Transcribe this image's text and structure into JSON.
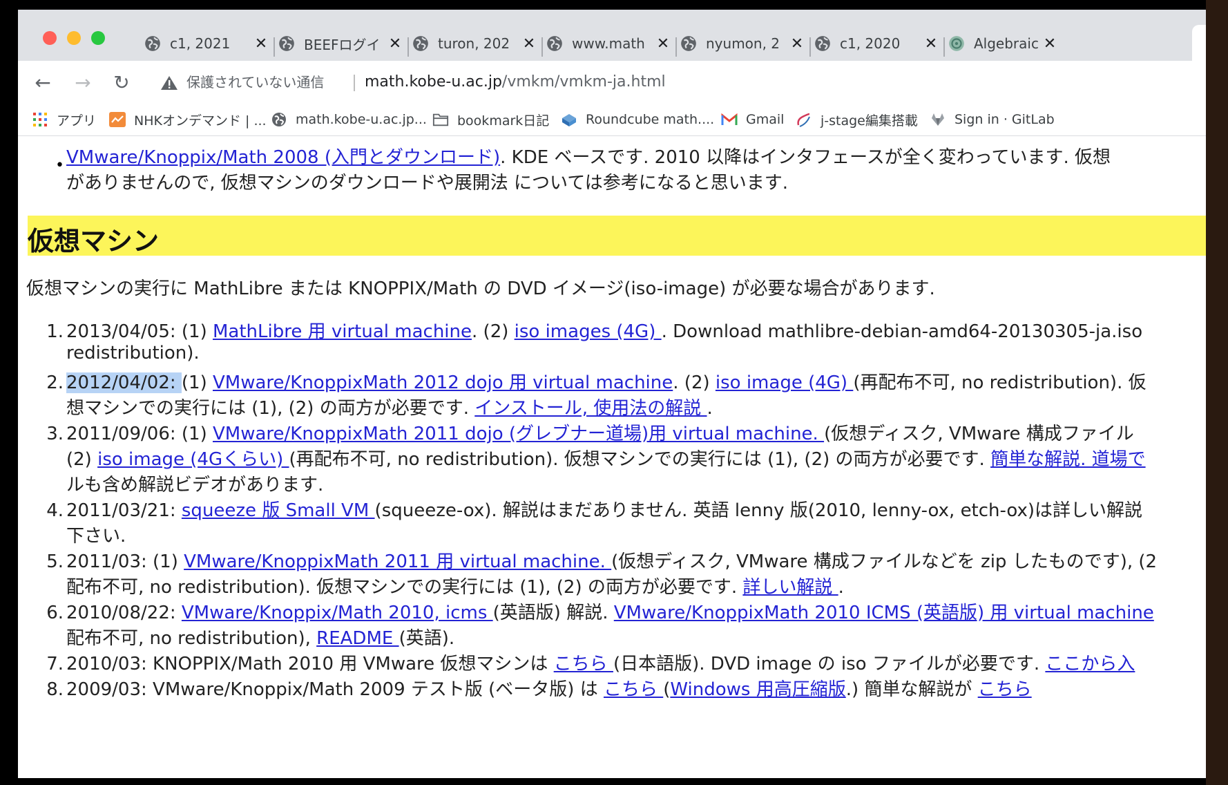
{
  "tabs": [
    {
      "label": "c1, 2021"
    },
    {
      "label": "BEEFログイ"
    },
    {
      "label": "turon, 202"
    },
    {
      "label": "www.math"
    },
    {
      "label": "nyumon, 2"
    },
    {
      "label": "c1, 2020"
    },
    {
      "label": "Algebraic S"
    }
  ],
  "tab_close": "✕",
  "toolbar": {
    "back": "←",
    "forward": "→",
    "reload": "↻",
    "security_text": "保護されていない通信",
    "url_host": "math.kobe-u.ac.jp",
    "url_path": "/vmkm/vmkm-ja.html"
  },
  "bookmarks": [
    {
      "label": "アプリ"
    },
    {
      "label": "NHKオンデマンド | ..."
    },
    {
      "label": "math.kobe-u.ac.jp..."
    },
    {
      "label": "bookmark日記"
    },
    {
      "label": "Roundcube math...."
    },
    {
      "label": "Gmail"
    },
    {
      "label": "j-stage編集搭載"
    },
    {
      "label": "Sign in · GitLab"
    }
  ],
  "intro_bullet": {
    "link": "VMware/Knoppix/Math 2008 (入門とダウンロード)",
    "text1": ". KDE ベースです. 2010 以降はインタフェースが全く変わっています. 仮想",
    "text2": "がありませんので, 仮想マシンのダウンロードや展開法 については参考になると思います."
  },
  "heading": "仮想マシン",
  "intro_paragraph": "仮想マシンの実行に MathLibre または KNOPPIX/Math の DVD イメージ(iso-image) が必要な場合があります.",
  "items": [
    {
      "num": "1.",
      "l1_a": "2013/04/05: (1) ",
      "l1_link1": "MathLibre 用 virtual machine",
      "l1_b": ". (2) ",
      "l1_link2": "iso images (4G) ",
      "l1_c": ". Download mathlibre-debian-amd64-20130305-ja.iso",
      "l2": "redistribution)."
    },
    {
      "num": "2.",
      "l1_hl": "2012/04/02: ",
      "l1_a": "(1) ",
      "l1_link1": "VMware/KnoppixMath 2012 dojo 用 virtual machine",
      "l1_b": ". (2) ",
      "l1_link2": "iso image (4G) ",
      "l1_c": "(再配布不可, no redistribution). 仮",
      "l2_a": "想マシンでの実行には (1), (2) の両方が必要です. ",
      "l2_link": "インストール, 使用法の解説 ",
      "l2_b": "."
    },
    {
      "num": "3.",
      "l1_a": "2011/09/06: (1) ",
      "l1_link1": "VMware/KnoppixMath 2011 dojo (グレブナー道場)用 virtual machine. ",
      "l1_c": "(仮想ディスク, VMware 構成ファイル",
      "l2_a": "(2) ",
      "l2_link": "iso image (4Gくらい) ",
      "l2_b": "(再配布不可, no redistribution). 仮想マシンでの実行には (1), (2) の両方が必要です. ",
      "l2_link2": "簡単な解説. 道場で",
      "l3": "ルも含め解説ビデオがあります."
    },
    {
      "num": "4.",
      "l1_a": "2011/03/21: ",
      "l1_link1": "squeeze 版 Small VM ",
      "l1_c": "(squeeze-ox). 解説はまだありません. 英語 lenny 版(2010, lenny-ox, etch-ox)は詳しい解説",
      "l2": "下さい."
    },
    {
      "num": "5.",
      "l1_a": "2011/03: (1) ",
      "l1_link1": "VMware/KnoppixMath 2011 用 virtual machine. ",
      "l1_c": "(仮想ディスク, VMware 構成ファイルなどを zip したものです), (2",
      "l2_a": "配布不可, no redistribution). 仮想マシンでの実行には (1), (2) の両方が必要です. ",
      "l2_link": "詳しい解説 ",
      "l2_b": "."
    },
    {
      "num": "6.",
      "l1_a": "2010/08/22: ",
      "l1_link1": "VMware/Knoppix/Math 2010, icms ",
      "l1_b": "(英語版) 解説. ",
      "l1_link2": "VMware/KnoppixMath 2010 ICMS (英語版) 用 virtual machine",
      "l2_a": "配布不可, no redistribution), ",
      "l2_link": "README ",
      "l2_b": "(英語)."
    },
    {
      "num": "7.",
      "l1_a": "2010/03: KNOPPIX/Math 2010 用 VMware 仮想マシンは ",
      "l1_link1": "こちら ",
      "l1_b": "(日本語版). DVD image の iso ファイルが必要です. ",
      "l1_link2": "ここから入"
    },
    {
      "num": "8.",
      "l1_a": "2009/03: VMware/Knoppix/Math 2009 テスト版 (ベータ版) は ",
      "l1_link1": "こちら ",
      "l1_b": "(",
      "l1_link2": "Windows 用高圧縮版",
      "l1_c": ".) 簡単な解説が ",
      "l1_link3": "こちら"
    }
  ]
}
